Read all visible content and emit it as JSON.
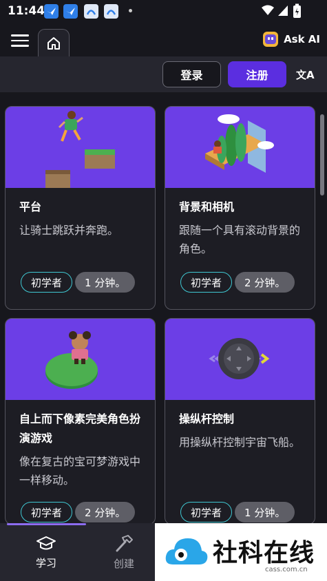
{
  "status_bar": {
    "time": "11:44"
  },
  "header": {
    "ask_ai_label": "Ask AI"
  },
  "auth": {
    "login_label": "登录",
    "signup_label": "注册",
    "translate_glyph": "文A"
  },
  "cards": [
    {
      "title": "平台",
      "desc": "让骑士跳跃并奔跑。",
      "level": "初学者",
      "duration": "1 分钟。"
    },
    {
      "title": "背景和相机",
      "desc": "跟随一个具有滚动背景的角色。",
      "level": "初学者",
      "duration": "2 分钟。"
    },
    {
      "title": "自上而下像素完美角色扮演游戏",
      "desc": "像在复古的宝可梦游戏中一样移动。",
      "level": "初学者",
      "duration": "2 分钟。"
    },
    {
      "title": "操纵杆控制",
      "desc": "用操纵杆控制宇宙飞船。",
      "level": "初学者",
      "duration": "1 分钟。"
    }
  ],
  "bottom_nav": {
    "learn_label": "学习",
    "create_label": "创建"
  },
  "watermark": {
    "brand": "社科在线",
    "domain": "cass.com.cn"
  },
  "colors": {
    "accent_purple": "#5b2ee0",
    "card_art": "#6c3ee6",
    "level_border": "#3fc9d3",
    "background": "#17171d"
  }
}
